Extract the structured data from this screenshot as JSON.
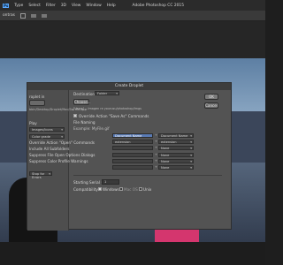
{
  "menu": {
    "logo": "Ps",
    "items": [
      "Type",
      "Select",
      "Filter",
      "3D",
      "View",
      "Window",
      "Help"
    ],
    "app_title": "Adobe Photoshop CC 2015"
  },
  "options": {
    "label": "ontras"
  },
  "dialog": {
    "title": "Create Droplet",
    "destination_label": "Destination:",
    "destination_value": "Folder",
    "choose_label": "Choose...",
    "path_text": "[Users] ...Imagen re yourusu/photoshop/Imgs",
    "override_label": "Override Action \"Save As\" Commands",
    "file_naming_label": "File Naming",
    "example_label": "Example: MyFile.gif",
    "naming_rows": [
      {
        "left": "Document Name",
        "right": "Document Name"
      },
      {
        "left": "extension",
        "right": "extension"
      },
      {
        "left": "",
        "right": "None"
      },
      {
        "left": "",
        "right": "None"
      },
      {
        "left": "",
        "right": "None"
      },
      {
        "left": "",
        "right": "None"
      }
    ],
    "starting_serial_label": "Starting Serial #:",
    "starting_serial_value": "1",
    "compat_label": "Compatibility:",
    "compat_windows": "Windows",
    "compat_macos": "Mac OS",
    "compat_unix": "Unix",
    "ok_label": "OK",
    "cancel_label": "Cancel"
  },
  "left_panel": {
    "save_label": "roplet in",
    "path_text": "bbin/Desktop/Droplet/Mac/Sw. file.app",
    "play_label": "Play",
    "set_value": "Images/Icons",
    "action_value": "Color grade",
    "options": [
      "Override Action \"Open\" Commands",
      "Include All Subfolders",
      "Suppress File Open Options Dialogs",
      "Suppress Color Profile Warnings"
    ],
    "errors_value": "Stop for Errors"
  }
}
